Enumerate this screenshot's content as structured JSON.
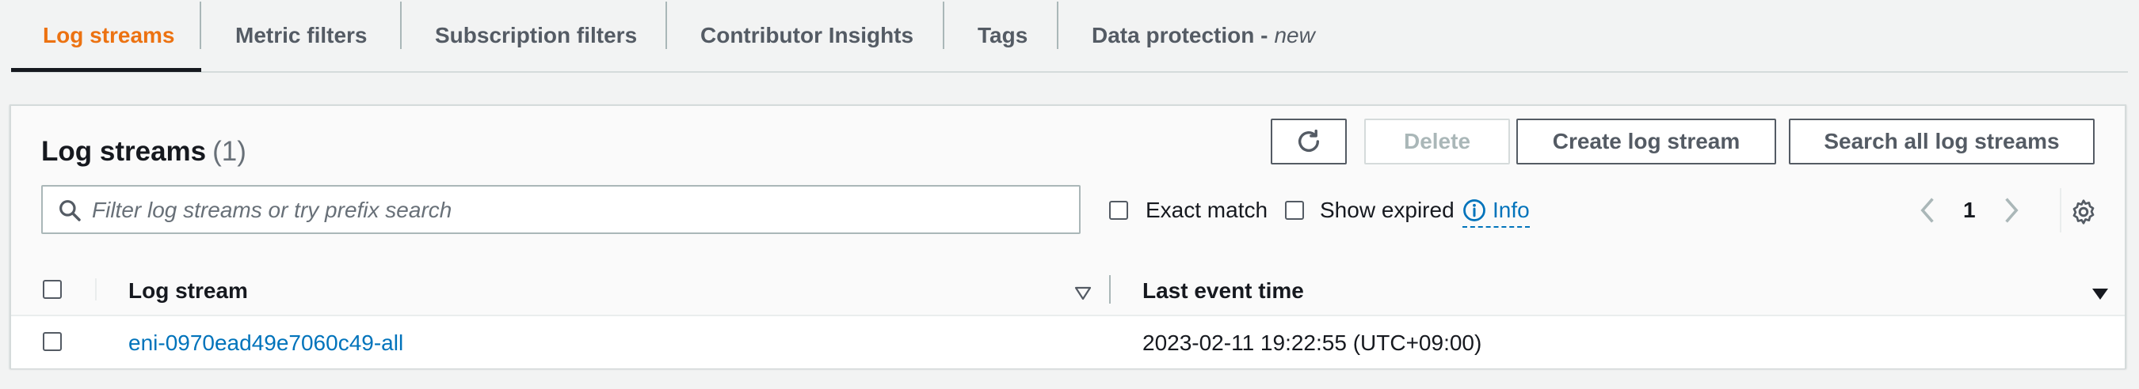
{
  "tabs": [
    {
      "label": "Log streams",
      "active": true
    },
    {
      "label": "Metric filters",
      "active": false
    },
    {
      "label": "Subscription filters",
      "active": false
    },
    {
      "label": "Contributor Insights",
      "active": false
    },
    {
      "label": "Tags",
      "active": false
    },
    {
      "label": "Data protection -",
      "suffix": "new",
      "active": false
    }
  ],
  "panel": {
    "title": "Log streams",
    "count": "(1)",
    "buttons": {
      "refresh_icon": "refresh-icon",
      "delete": "Delete",
      "create": "Create log stream",
      "search_all": "Search all log streams"
    },
    "search": {
      "placeholder": "Filter log streams or try prefix search",
      "value": ""
    },
    "exact_match_label": "Exact match",
    "show_expired_label": "Show expired",
    "info_label": "Info",
    "pagination": {
      "current_page": "1"
    }
  },
  "table": {
    "columns": [
      "Log stream",
      "Last event time"
    ],
    "rows": [
      {
        "log_stream": "eni-0970ead49e7060c49-all",
        "last_event_time": "2023-02-11 19:22:55 (UTC+09:00)"
      }
    ]
  },
  "colors": {
    "accent_tab": "#ec7211",
    "link": "#0073bb",
    "button_border": "#545b64",
    "disabled": "#aab7b8"
  }
}
